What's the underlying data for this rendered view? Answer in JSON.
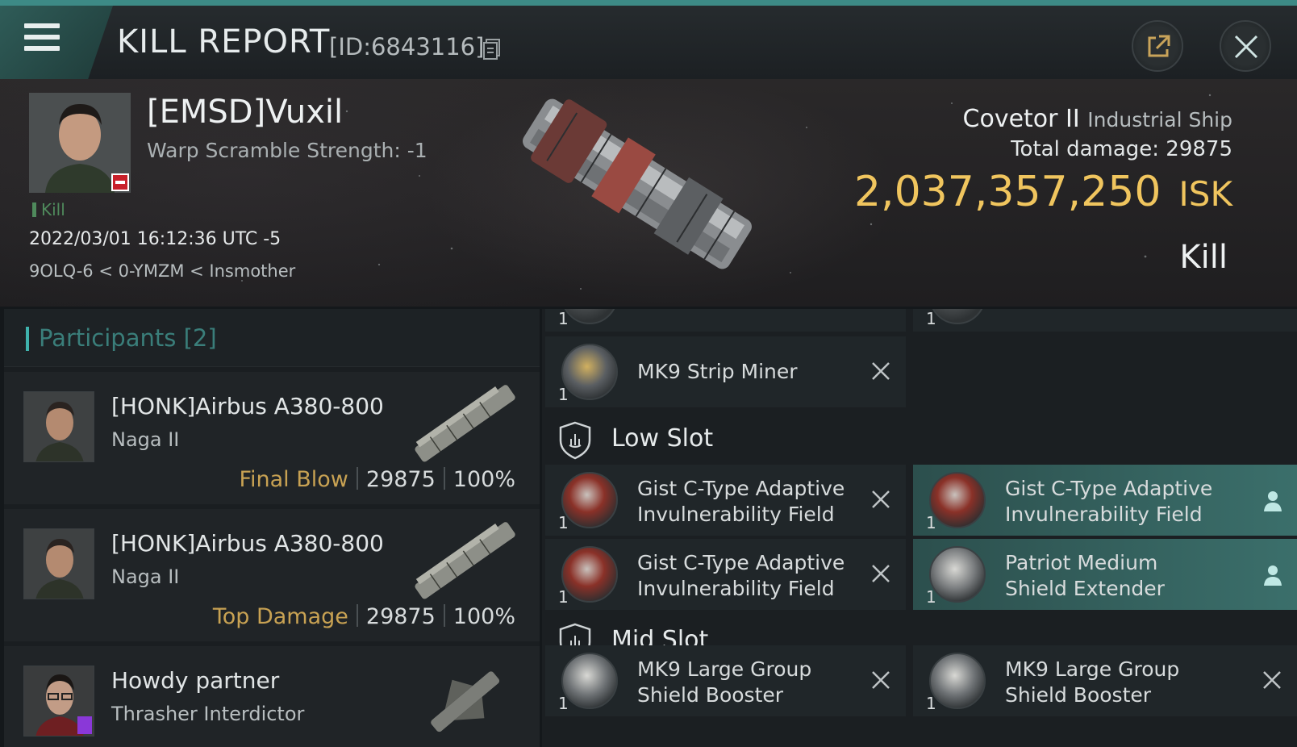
{
  "header": {
    "title": "KILL REPORT",
    "report_id": "[ID:6843116]"
  },
  "victim": {
    "name": "[EMSD]Vuxil",
    "sub": "Warp Scramble Strength: -1",
    "tag": "Kill",
    "datetime": "2022/03/01 16:12:36 UTC -5",
    "location": "9OLQ-6 < 0-YMZM < Insmother",
    "ship_name": "Covetor II",
    "ship_class": "Industrial Ship",
    "total_damage": "Total damage:  29875",
    "isk_value": "2,037,357,250",
    "isk_currency": "ISK",
    "outcome": "Kill"
  },
  "participants": {
    "header": "Participants [2]",
    "rows": [
      {
        "name": "[HONK]Airbus A380-800",
        "ship": "Naga II",
        "tag": "Final Blow",
        "damage": "29875",
        "percent": "100%"
      },
      {
        "name": "[HONK]Airbus A380-800",
        "ship": "Naga II",
        "tag": "Top Damage",
        "damage": "29875",
        "percent": "100%"
      },
      {
        "name": "Howdy partner",
        "ship": "Thrasher Interdictor"
      }
    ]
  },
  "fitting": {
    "partial_qty_left": "1",
    "partial_qty_right": "1",
    "high": [
      {
        "line1": "MK9 Strip Miner",
        "qty": "1",
        "status": "destroyed"
      }
    ],
    "low_title": "Low Slot",
    "low": [
      {
        "line1": "Gist C-Type Adaptive",
        "line2": "Invulnerability Field",
        "qty": "1",
        "status": "destroyed"
      },
      {
        "line1": "Gist C-Type Adaptive",
        "line2": "Invulnerability Field",
        "qty": "1",
        "status": "dropped"
      },
      {
        "line1": "Gist C-Type Adaptive",
        "line2": "Invulnerability Field",
        "qty": "1",
        "status": "destroyed"
      },
      {
        "line1": "Patriot Medium",
        "line2": "Shield Extender",
        "qty": "1",
        "status": "dropped"
      }
    ],
    "mid_title": "Mid Slot",
    "mid": [
      {
        "line1": "MK9 Large Group",
        "line2": "Shield Booster",
        "qty": "1",
        "status": "destroyed"
      },
      {
        "line1": "MK9 Large Group",
        "line2": "Shield Booster",
        "qty": "1",
        "status": "destroyed"
      }
    ]
  },
  "colors": {
    "accent": "#3d8a86",
    "isk": "#f0c55e",
    "tag_gold": "#c8a253",
    "kill_green": "#4f8a5c",
    "dropped_bg": "#3b6f6b"
  }
}
